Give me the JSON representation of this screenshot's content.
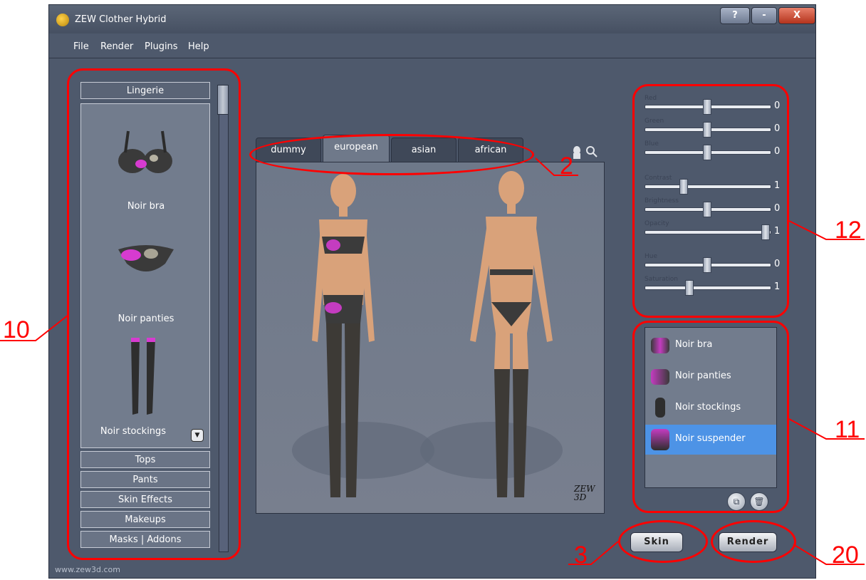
{
  "window": {
    "title": "ZEW Clother Hybrid",
    "help": "?",
    "minimize": "-",
    "close": "X"
  },
  "menu": [
    "File",
    "Render",
    "Plugins",
    "Help"
  ],
  "catalog": {
    "active_category": "Lingerie",
    "items": [
      "Noir bra",
      "Noir panties",
      "Noir stockings"
    ],
    "categories": [
      "Tops",
      "Pants",
      "Skin Effects",
      "Makeups",
      "Masks | Addons"
    ]
  },
  "tabs": [
    "dummy",
    "european",
    "asian",
    "african"
  ],
  "active_tab": "european",
  "viewer": {
    "logo": "ZEW 3D"
  },
  "adjustments": [
    {
      "label": "Red",
      "value": "0",
      "level": 0.5
    },
    {
      "label": "Green",
      "value": "0",
      "level": 0.5
    },
    {
      "label": "Blue",
      "value": "0",
      "level": 0.5
    },
    {
      "label": "Contrast",
      "value": "1",
      "level": 0.3
    },
    {
      "label": "Brightness",
      "value": "0",
      "level": 0.5
    },
    {
      "label": "Opacity",
      "value": "1",
      "level": 1.0
    },
    {
      "label": "Hue",
      "value": "0",
      "level": 0.5
    },
    {
      "label": "Saturation",
      "value": "1",
      "level": 0.35
    }
  ],
  "applied": {
    "items": [
      "Noir bra",
      "Noir panties",
      "Noir stockings",
      "Noir suspender"
    ],
    "selected": "Noir suspender"
  },
  "buttons": {
    "skin": "Skin",
    "render": "Render"
  },
  "callouts": {
    "c10": "10",
    "c2": "2",
    "c12": "12",
    "c11": "11",
    "c3": "3",
    "c20": "20"
  },
  "footer": "www.zew3d.com",
  "colors": {
    "annotation": "#ff0000",
    "selection": "#4d93e6",
    "window_bg": "#4e596c"
  }
}
